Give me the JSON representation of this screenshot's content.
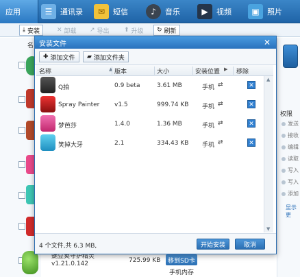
{
  "nav": {
    "tabs": [
      {
        "label": "应用",
        "icon": "apps-icon"
      },
      {
        "label": "通讯录",
        "icon": "contacts-icon"
      },
      {
        "label": "短信",
        "icon": "sms-icon"
      },
      {
        "label": "音乐",
        "icon": "music-icon"
      },
      {
        "label": "视频",
        "icon": "video-icon"
      },
      {
        "label": "照片",
        "icon": "photos-icon"
      }
    ]
  },
  "toolbar": {
    "install": "安装",
    "uninstall": "卸载",
    "export": "导出",
    "upgrade": "升级",
    "refresh": "刷新"
  },
  "background": {
    "col_name_partial": "名",
    "right_panel": {
      "heading": "权限",
      "items": [
        "发送",
        "接收",
        "编辑",
        "读取",
        "写入",
        "写入",
        "添加"
      ],
      "link": "显示更"
    },
    "bottom_app": {
      "name": "豌豆荚守护精灵",
      "version": "v1.21.0.142",
      "size": "725.99 KB",
      "move_button": "移到SD卡",
      "location": "手机内存"
    }
  },
  "dialog": {
    "title": "安装文件",
    "add_file": "添加文件",
    "add_folder": "添加文件夹",
    "columns": {
      "name": "名称",
      "version": "版本",
      "size": "大小",
      "location": "安装位置",
      "remove": "移除"
    },
    "rows": [
      {
        "name": "Q拍",
        "version": "0.9 beta",
        "size": "3.61 MB",
        "location": "手机"
      },
      {
        "name": "Spray Painter",
        "version": "v1.5",
        "size": "999.74 KB",
        "location": "手机"
      },
      {
        "name": "梦芭莎",
        "version": "1.4.0",
        "size": "1.36 MB",
        "location": "手机"
      },
      {
        "name": "笑掉大牙",
        "version": "2.1",
        "size": "334.43 KB",
        "location": "手机"
      }
    ],
    "summary": "4 个文件,共 6.3 MB,",
    "start_button": "开始安装",
    "cancel_button": "取消"
  },
  "colors": {
    "nav_bg": "#2a72bd",
    "button_blue": "#2b6fb3"
  }
}
